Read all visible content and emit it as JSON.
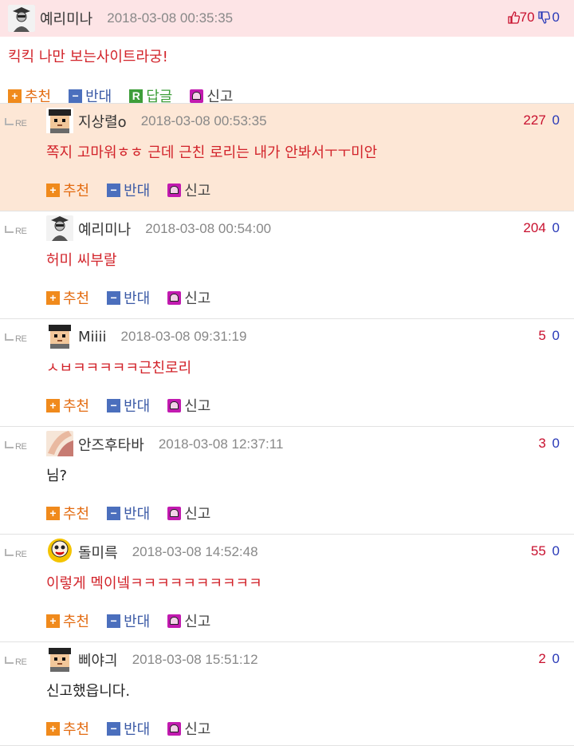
{
  "labels": {
    "recommend": "추천",
    "oppose": "반대",
    "reply": "답글",
    "report": "신고",
    "re": "RE"
  },
  "root": {
    "nick": "예리미나",
    "date": "2018-03-08 00:35:35",
    "up": "70",
    "down": "0",
    "text": "킥킥 나만 보는사이트라궁!"
  },
  "replies": [
    {
      "nick": "지상렬o",
      "date": "2018-03-08 00:53:35",
      "up": "227",
      "down": "0",
      "text": "쪽지 고마워ㅎㅎ 근데 근친 로리는 내가 안봐서ㅜㅜ미안",
      "avatar": "pixel-avatar",
      "highlight": true,
      "text_color": "red"
    },
    {
      "nick": "예리미나",
      "date": "2018-03-08 00:54:00",
      "up": "204",
      "down": "0",
      "text": "허미 씨부랄",
      "avatar": "sketch-avatar",
      "highlight": false,
      "text_color": "red"
    },
    {
      "nick": "Miiii",
      "date": "2018-03-08 09:31:19",
      "up": "5",
      "down": "0",
      "text": "ㅅㅂㅋㅋㅋㅋㅋ근친로리",
      "avatar": "pixel-avatar",
      "highlight": false,
      "text_color": "red"
    },
    {
      "nick": "안즈후타바",
      "date": "2018-03-08 12:37:11",
      "up": "3",
      "down": "0",
      "text": "님?",
      "avatar": "photo-avatar",
      "highlight": false,
      "text_color": "black"
    },
    {
      "nick": "돌미륵",
      "date": "2018-03-08 14:52:48",
      "up": "55",
      "down": "0",
      "text": "이렇게 멕이넼ㅋㅋㅋㅋㅋㅋㅋㅋㅋㅋ",
      "avatar": "cartoon-avatar",
      "highlight": false,
      "text_color": "red"
    },
    {
      "nick": "삐야긔",
      "date": "2018-03-08 15:51:12",
      "up": "2",
      "down": "0",
      "text": "신고했읍니다.",
      "avatar": "pixel-avatar",
      "highlight": false,
      "text_color": "black"
    }
  ],
  "colors": {
    "up": "#c8102e",
    "down": "#2a3ab8",
    "root_bg": "#fde4e6",
    "highlight_bg": "#fde7d6"
  }
}
